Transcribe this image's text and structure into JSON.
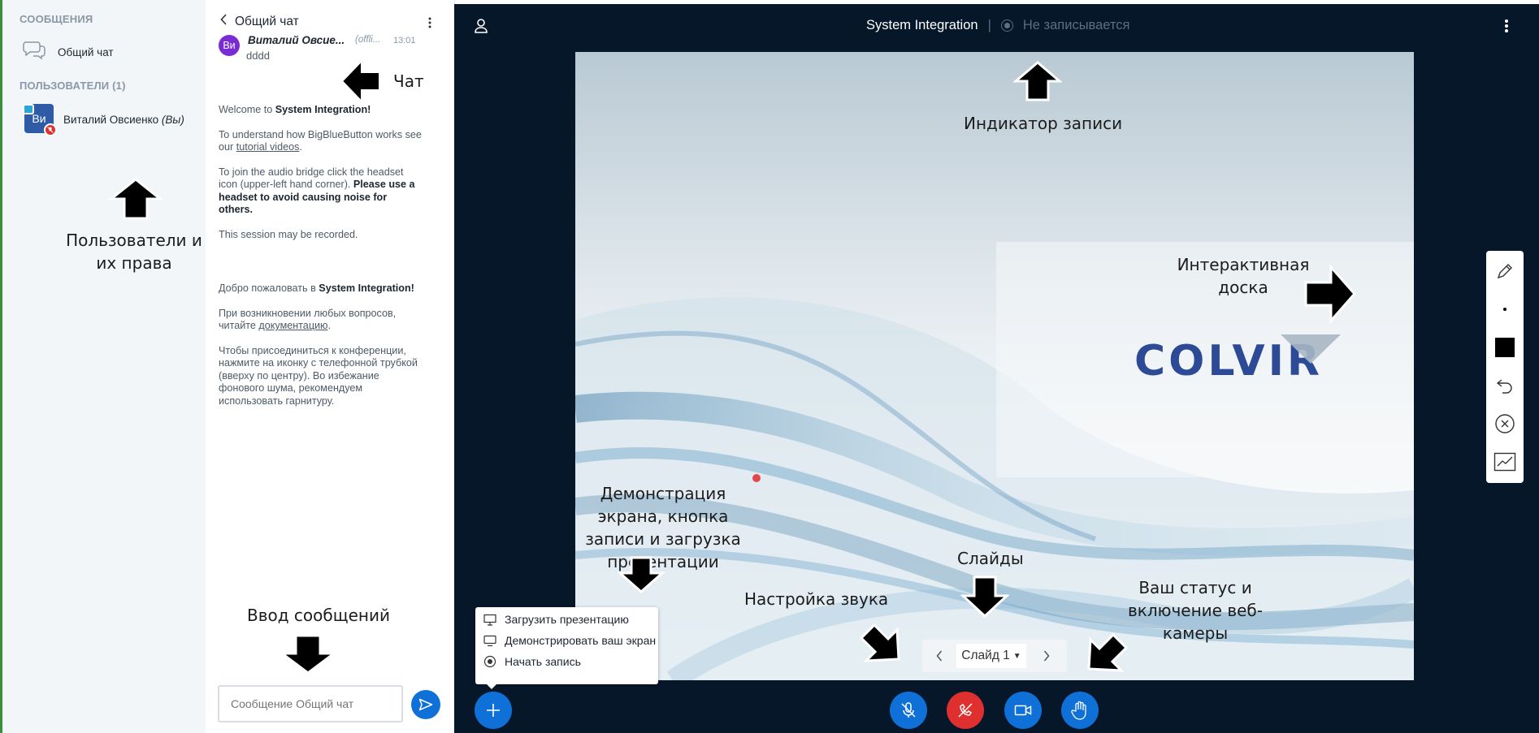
{
  "user_panel": {
    "messages_header": "СООБЩЕНИЯ",
    "public_chat_label": "Общий чат",
    "users_header": "ПОЛЬЗОВАТЕЛИ (1)",
    "user": {
      "initials": "Ви",
      "name": "Виталий Овсиенко",
      "you_suffix": "(Вы)"
    }
  },
  "chat": {
    "title": "Общий чат",
    "message": {
      "avatar": "Ви",
      "author": "Виталий Овсие...",
      "status": "(offli...",
      "time": "13:01",
      "text": "dddd"
    },
    "welcome_en": {
      "p1_pre": "Welcome to ",
      "p1_bold": "System Integration!",
      "p2_pre": "To understand how BigBlueButton works see our ",
      "p2_link": "tutorial videos",
      "p2_post": ".",
      "p3_pre": "To join the audio bridge click the headset icon (upper-left hand corner). ",
      "p3_bold": "Please use a headset to avoid causing noise for others.",
      "p4": "This session may be recorded."
    },
    "welcome_ru": {
      "p1_pre": "Добро пожаловать в ",
      "p1_bold": "System Integration!",
      "p2_pre": "При возникновении любых вопросов, читайте ",
      "p2_link": "документацию",
      "p2_post": ".",
      "p3": "Чтобы присоединиться к конференции, нажмите на иконку с телефонной трубкой (вверху по центру). Во избежание фонового шума, рекомендуем использовать гарнитуру."
    },
    "input_placeholder": "Сообщение Общий чат"
  },
  "header": {
    "meeting_title": "System Integration",
    "separator": "|",
    "recording_status": "Не записывается"
  },
  "slide": {
    "logo_text": "COLVIR"
  },
  "slide_nav": {
    "current": "Слайд 1"
  },
  "actions_menu": {
    "items": [
      "Загрузить презентацию",
      "Демонстрировать ваш экран",
      "Начать запись"
    ]
  },
  "annotations": {
    "chat": "Чат",
    "users": "Пользователи и их права",
    "message_input": "Ввод сообщений",
    "recording_indicator": "Индикатор записи",
    "whiteboard": "Интерактивная доска",
    "screen_share": "Демонстрация экрана, кнопка записи и загрузка презентации",
    "audio_settings": "Настройка звука",
    "slides": "Слайды",
    "status_webcam": "Ваш статус и включение веб-камеры"
  },
  "colors": {
    "stage_bg": "#06172a",
    "accent_blue": "#0f70d7",
    "mute_red": "#e02f2f",
    "recording_gray": "#5c6e80"
  }
}
